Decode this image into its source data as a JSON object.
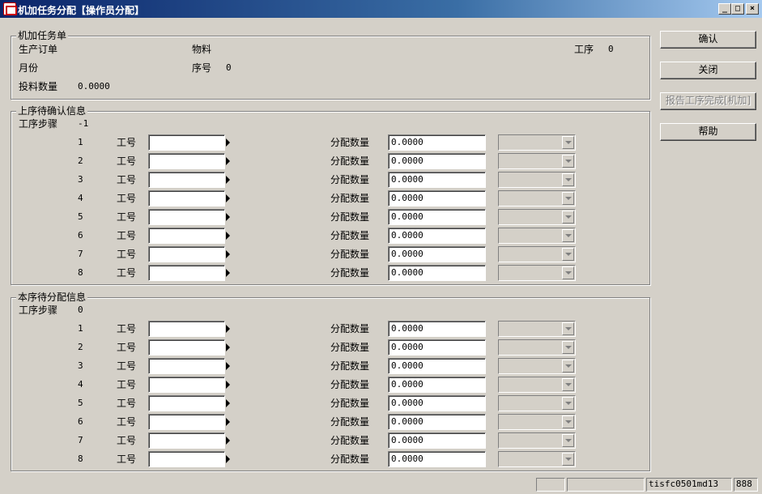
{
  "window": {
    "title": "机加任务分配【操作员分配】",
    "minimize": "_",
    "maximize": "□",
    "close": "×"
  },
  "task": {
    "group_title": "机加任务单",
    "order_label": "生产订单",
    "material_label": "物料",
    "process_label": "工序",
    "process_value": "0",
    "month_label": "月份",
    "seq_label": "序号",
    "seq_value": "0",
    "qty_label": "投料数量",
    "qty_value": "0.0000"
  },
  "upper": {
    "group_title": "上序待确认信息",
    "step_label": "工序步骤",
    "step_value": "-1",
    "rows": [
      {
        "n": "1",
        "emp_label": "工号",
        "emp": "",
        "qty_label": "分配数量",
        "qty": "0.0000"
      },
      {
        "n": "2",
        "emp_label": "工号",
        "emp": "",
        "qty_label": "分配数量",
        "qty": "0.0000"
      },
      {
        "n": "3",
        "emp_label": "工号",
        "emp": "",
        "qty_label": "分配数量",
        "qty": "0.0000"
      },
      {
        "n": "4",
        "emp_label": "工号",
        "emp": "",
        "qty_label": "分配数量",
        "qty": "0.0000"
      },
      {
        "n": "5",
        "emp_label": "工号",
        "emp": "",
        "qty_label": "分配数量",
        "qty": "0.0000"
      },
      {
        "n": "6",
        "emp_label": "工号",
        "emp": "",
        "qty_label": "分配数量",
        "qty": "0.0000"
      },
      {
        "n": "7",
        "emp_label": "工号",
        "emp": "",
        "qty_label": "分配数量",
        "qty": "0.0000"
      },
      {
        "n": "8",
        "emp_label": "工号",
        "emp": "",
        "qty_label": "分配数量",
        "qty": "0.0000"
      }
    ]
  },
  "current": {
    "group_title": "本序待分配信息",
    "step_label": "工序步骤",
    "step_value": "0",
    "rows": [
      {
        "n": "1",
        "emp_label": "工号",
        "emp": "",
        "qty_label": "分配数量",
        "qty": "0.0000"
      },
      {
        "n": "2",
        "emp_label": "工号",
        "emp": "",
        "qty_label": "分配数量",
        "qty": "0.0000"
      },
      {
        "n": "3",
        "emp_label": "工号",
        "emp": "",
        "qty_label": "分配数量",
        "qty": "0.0000"
      },
      {
        "n": "4",
        "emp_label": "工号",
        "emp": "",
        "qty_label": "分配数量",
        "qty": "0.0000"
      },
      {
        "n": "5",
        "emp_label": "工号",
        "emp": "",
        "qty_label": "分配数量",
        "qty": "0.0000"
      },
      {
        "n": "6",
        "emp_label": "工号",
        "emp": "",
        "qty_label": "分配数量",
        "qty": "0.0000"
      },
      {
        "n": "7",
        "emp_label": "工号",
        "emp": "",
        "qty_label": "分配数量",
        "qty": "0.0000"
      },
      {
        "n": "8",
        "emp_label": "工号",
        "emp": "",
        "qty_label": "分配数量",
        "qty": "0.0000"
      }
    ]
  },
  "buttons": {
    "confirm": "确认",
    "close": "关闭",
    "report": "报告工序完成[机加]",
    "help": "帮助"
  },
  "statusbar": {
    "cell1": "",
    "cell2": "",
    "form_id": "tisfc0501md13",
    "code": "888"
  },
  "icons": {
    "app": "app-icon",
    "dropdown": "chevron-down-icon",
    "field_pointer": "triangle-right-icon"
  }
}
